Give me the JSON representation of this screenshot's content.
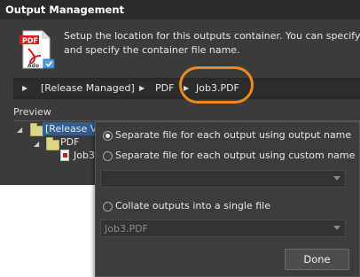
{
  "dialog": {
    "title": "Output Management",
    "description_line1": "Setup the location for this outputs container. You can specify a",
    "description_line2": "and specify the container file name.",
    "icon": "pdf-document-icon",
    "icon_label": "PDF",
    "icon_sublabel": "Ado"
  },
  "breadcrumb": {
    "items": [
      "[Release Managed]",
      "PDF",
      "Job3.PDF"
    ],
    "separator_icon": "triangle-right-icon"
  },
  "highlight_color": "#f08a1c",
  "preview": {
    "label": "Preview",
    "tree": {
      "root": "[Release Va",
      "child": "PDF",
      "grandchild": "Job3"
    }
  },
  "popup": {
    "options": [
      {
        "label": "Separate file for each output using output name",
        "checked": true
      },
      {
        "label": "Separate file for each output using custom name",
        "checked": false
      },
      {
        "label": "Collate outputs into a single file",
        "checked": false
      }
    ],
    "custom_name_value": "",
    "single_file_value": "Job3.PDF",
    "done_label": "Done"
  }
}
